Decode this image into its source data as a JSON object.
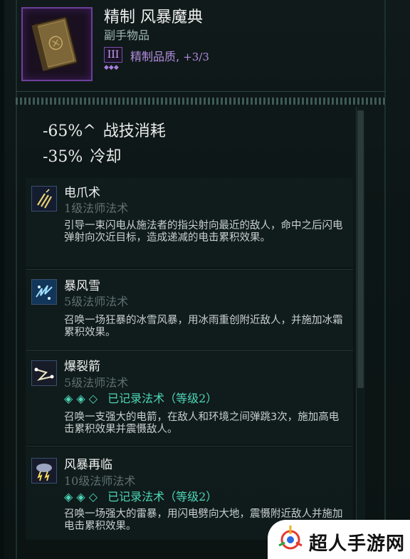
{
  "item": {
    "title": "精制 风暴魔典",
    "subtitle": "副手物品",
    "tier": "III",
    "tier_dots": "◆◆◆",
    "quality_label": "精制品质,",
    "quality_value": "+3/3",
    "icon": "grimoire-book-icon"
  },
  "stats": [
    {
      "value": "-65%^",
      "label": "战技消耗"
    },
    {
      "value": "-35%",
      "label": "冷却"
    }
  ],
  "skills": [
    {
      "name": "电爪术",
      "level_num": "1",
      "level_text": "级法师法术",
      "recorded": null,
      "description": "引导一束闪电从施法者的指尖射向最近的敌人，命中之后闪电弹射向次近目标，造成递减的电击累积效果。",
      "icon": "lightning-claw-icon"
    },
    {
      "name": "暴风雪",
      "level_num": "5",
      "level_text": "级法师法术",
      "recorded": null,
      "description": "召唤一场狂暴的冰雪风暴，用冰雨重创附近敌人，并施加冰霜累积效果。",
      "icon": "blizzard-icon"
    },
    {
      "name": "爆裂箭",
      "level_num": "5",
      "level_text": "级法师法术",
      "recorded": {
        "gems": "◈ ◈ ◇",
        "text": "已记录法术（等级",
        "level": "2",
        "close": "）"
      },
      "description": "召唤一支强大的电箭，在敌人和环境之间弹跳3次，施加高电击累积效果并震慑敌人。",
      "icon": "burst-arrow-icon"
    },
    {
      "name": "风暴再临",
      "level_num": "10",
      "level_text": "级法师法术",
      "recorded": {
        "gems": "◈ ◈ ◇",
        "text": "已记录法术（等级",
        "level": "2",
        "close": "）"
      },
      "description": "召唤一场强大的雷暴，用闪电劈向大地，震慑附近敌人并施加电击累积效果。",
      "icon": "storm-cloud-icon"
    }
  ],
  "watermark": {
    "text": "超人手游网"
  },
  "colors": {
    "background": "#0c1414",
    "accent_purple": "#b38ce0",
    "recorded_teal": "#4dd6b8",
    "muted_level": "#5f7070"
  }
}
